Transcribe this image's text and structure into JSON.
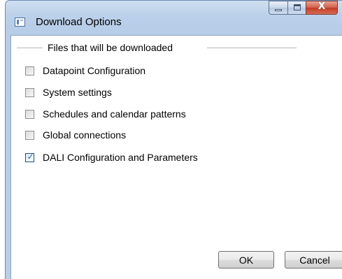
{
  "window": {
    "title": "Download Options",
    "icon": "window-app-icon",
    "caption_buttons": {
      "minimize": "minimize-icon",
      "maximize": "maximize-icon",
      "close_glyph": "X"
    }
  },
  "group": {
    "legend": "Files that will be downloaded",
    "items": [
      {
        "label": "Datapoint Configuration",
        "checked": false
      },
      {
        "label": "System settings",
        "checked": false
      },
      {
        "label": "Schedules and calendar patterns",
        "checked": false
      },
      {
        "label": "Global connections",
        "checked": false
      },
      {
        "label": "DALI Configuration and Parameters",
        "checked": true
      }
    ]
  },
  "buttons": {
    "ok": "OK",
    "cancel": "Cancel"
  },
  "colors": {
    "accent": "#2a5fa5",
    "close": "#c23b26",
    "frame": "#b9cfe9"
  }
}
